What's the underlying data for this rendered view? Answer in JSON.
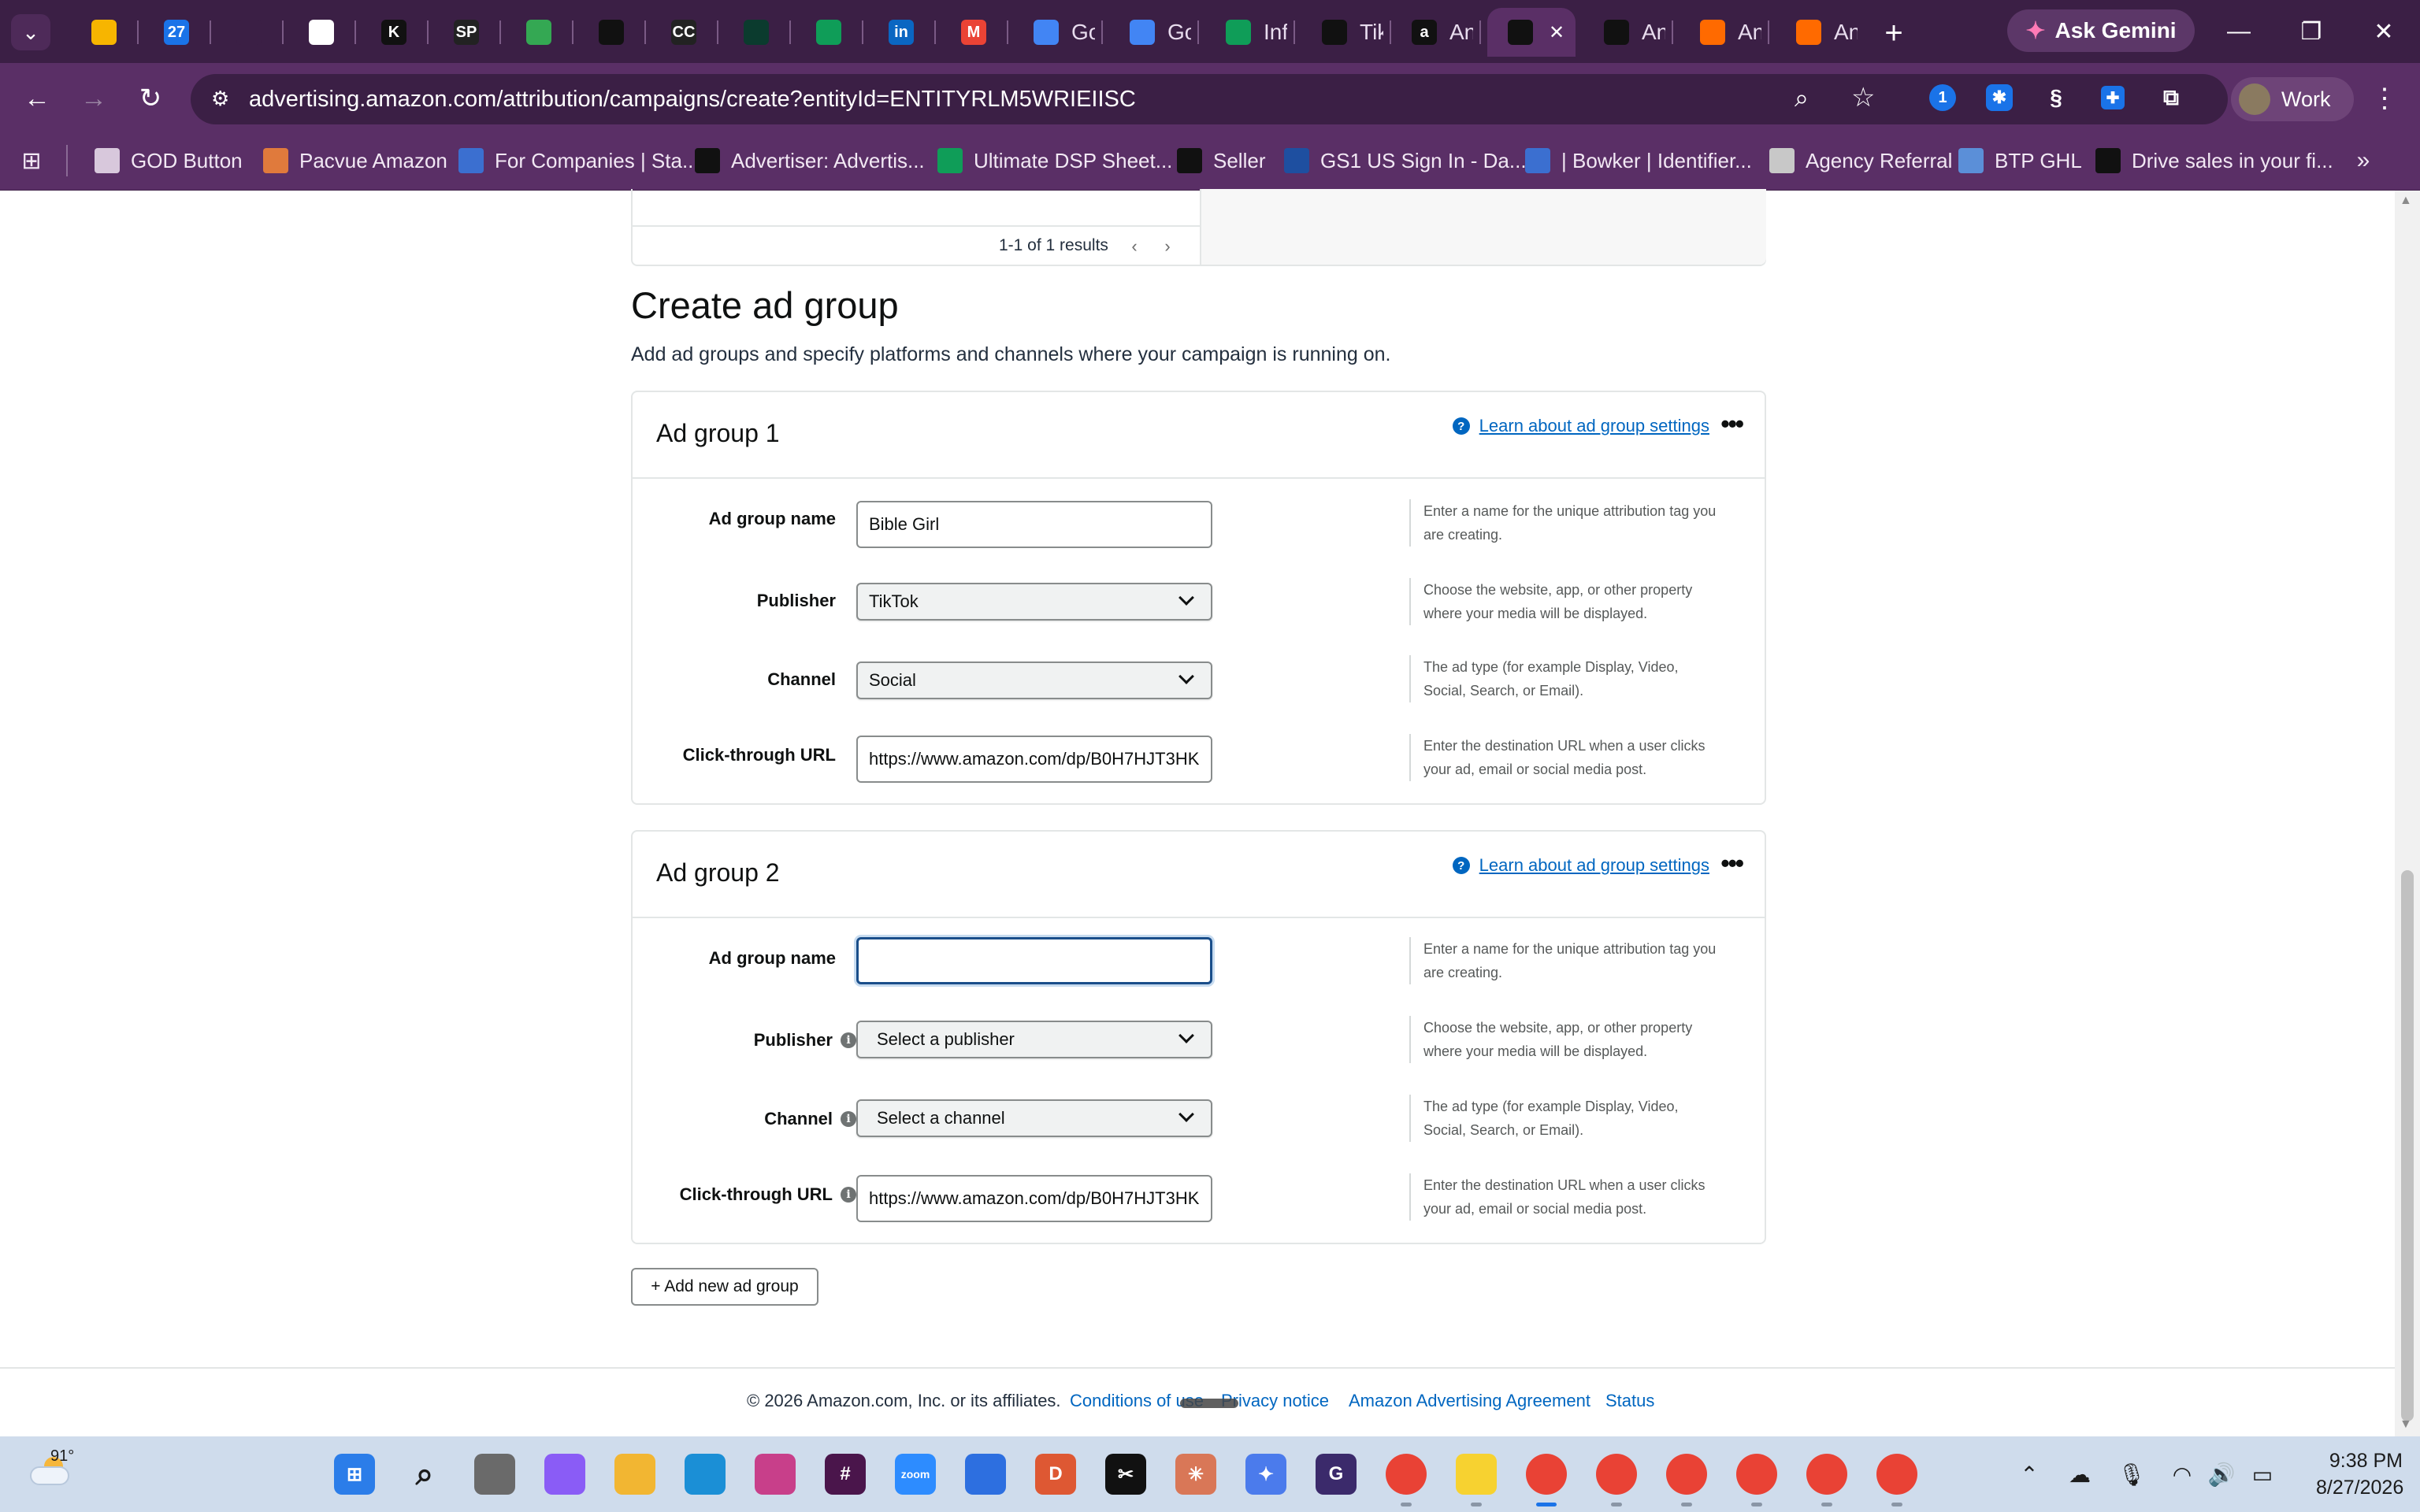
{
  "browser": {
    "tabs": [
      {
        "title": "",
        "icon": "lightbulb-icon",
        "color": "#f7b500"
      },
      {
        "title": "",
        "icon": "calendar-icon",
        "color": "#1a73e8",
        "glyph": "27"
      },
      {
        "title": "",
        "icon": "diamond-logo-icon",
        "color": "#3b1f45"
      },
      {
        "title": "",
        "icon": "clickup-icon",
        "color": "#ffffff"
      },
      {
        "title": "",
        "icon": "k-logo-icon",
        "color": "#111111",
        "glyph": "K"
      },
      {
        "title": "",
        "icon": "sp-logo-icon",
        "color": "#222222",
        "glyph": "SP"
      },
      {
        "title": "",
        "icon": "google-drive-icon",
        "color": "#34a853"
      },
      {
        "title": "",
        "icon": "triangle-logo-icon",
        "color": "#111111"
      },
      {
        "title": "",
        "icon": "cc4you-icon",
        "color": "#222222",
        "glyph": "CC"
      },
      {
        "title": "",
        "icon": "leaf-logo-icon",
        "color": "#0b3b2e"
      },
      {
        "title": "",
        "icon": "google-sheets-icon",
        "color": "#0f9d58"
      },
      {
        "title": "",
        "icon": "linkedin-icon",
        "color": "#0a66c2",
        "glyph": "in"
      },
      {
        "title": "",
        "icon": "gmail-icon",
        "color": "#ea4335",
        "glyph": "M"
      },
      {
        "title": "Go",
        "icon": "google-docs-icon",
        "color": "#4285f4"
      },
      {
        "title": "Go",
        "icon": "google-docs-icon",
        "color": "#4285f4"
      },
      {
        "title": "Inf",
        "icon": "google-sheets-icon",
        "color": "#0f9d58"
      },
      {
        "title": "Tik",
        "icon": "tiktok-icon",
        "color": "#111111"
      },
      {
        "title": "An",
        "icon": "amazon-icon",
        "color": "#111111",
        "glyph": "a"
      },
      {
        "title": "",
        "icon": "amazon-ads-icon",
        "color": "#111111",
        "active": true
      },
      {
        "title": "An",
        "icon": "amazon-ads-icon",
        "color": "#111111"
      },
      {
        "title": "An",
        "icon": "amazon-orange-icon",
        "color": "#ff6a00"
      },
      {
        "title": "An",
        "icon": "amazon-orange-icon",
        "color": "#ff6a00"
      }
    ],
    "gemini_label": "Ask Gemini",
    "url": "advertising.amazon.com/attribution/campaigns/create?entityId=ENTITYRLM5WRIEIISC",
    "profile_label": "Work",
    "bookmarks": [
      {
        "label": "GOD Button",
        "icon": "folder-icon"
      },
      {
        "label": "Pacvue Amazon",
        "icon": "pacvue-icon"
      },
      {
        "label": "For Companies | Sta...",
        "icon": "link-icon"
      },
      {
        "label": "Advertiser: Advertis...",
        "icon": "amazon-ads-icon"
      },
      {
        "label": "Ultimate DSP Sheet...",
        "icon": "google-sheets-icon"
      },
      {
        "label": "Seller",
        "icon": "amazon-icon"
      },
      {
        "label": "GS1 US Sign In - Da...",
        "icon": "gs1-icon"
      },
      {
        "label": "| Bowker | Identifier...",
        "icon": "bowker-icon"
      },
      {
        "label": "Agency Referral",
        "icon": "globe-icon"
      },
      {
        "label": "BTP GHL",
        "icon": "diamond-logo-icon"
      },
      {
        "label": "Drive sales in your fi...",
        "icon": "amazon-icon"
      }
    ]
  },
  "page": {
    "results_text": "1-1 of 1 results",
    "title": "Create ad group",
    "subtitle": "Add ad groups and specify platforms and channels where your campaign is running on.",
    "learn_link": "Learn about ad group settings",
    "labels": {
      "name": "Ad group name",
      "publisher": "Publisher",
      "channel": "Channel",
      "url": "Click-through URL"
    },
    "help": {
      "name": "Enter a name for the unique attribution tag you are creating.",
      "publisher": "Choose the website, app, or other property where your media will be displayed.",
      "channel": "The ad type (for example Display, Video, Social, Search, or Email).",
      "url": "Enter the destination URL when a user clicks your ad, email or social media post."
    },
    "groups": [
      {
        "title": "Ad group 1",
        "name_value": "Bible Girl",
        "publisher_value": "TikTok",
        "channel_value": "Social",
        "url_value": "https://www.amazon.com/dp/B0H7HJT3HK"
      },
      {
        "title": "Ad group 2",
        "name_value": "",
        "publisher_value": "Select a publisher",
        "channel_value": "Select a channel",
        "url_value": "https://www.amazon.com/dp/B0H7HJT3HK"
      }
    ],
    "add_button": "+ Add new ad group",
    "footer": {
      "copyright": "© 2026 Amazon.com, Inc. or its affiliates.",
      "conditions": "Conditions of use",
      "privacy": "Privacy notice",
      "agreement": "Amazon Advertising Agreement",
      "status": "Status"
    }
  },
  "taskbar": {
    "temperature": "91°",
    "time": "9:38 PM",
    "date": "8/27/2026",
    "apps": [
      "windows-start-icon",
      "search-icon",
      "task-view-icon",
      "copilot-icon",
      "file-explorer-icon",
      "edge-icon",
      "snipping-tool-icon",
      "slack-icon",
      "zoom-icon",
      "microsoft-store-icon",
      "duckduckgo-icon",
      "capcut-icon",
      "claude-icon",
      "gemini-icon",
      "g-app-icon",
      "chrome-icon",
      "sticky-notes-icon",
      "chrome-icon",
      "chrome-icon",
      "chrome-icon",
      "chrome-icon",
      "chrome-icon",
      "chrome-icon"
    ]
  },
  "colors": {
    "tabstrip": "#3b1f45",
    "toolbar": "#5a2f66",
    "link": "#0066c0",
    "focus": "#1a4e8a"
  }
}
